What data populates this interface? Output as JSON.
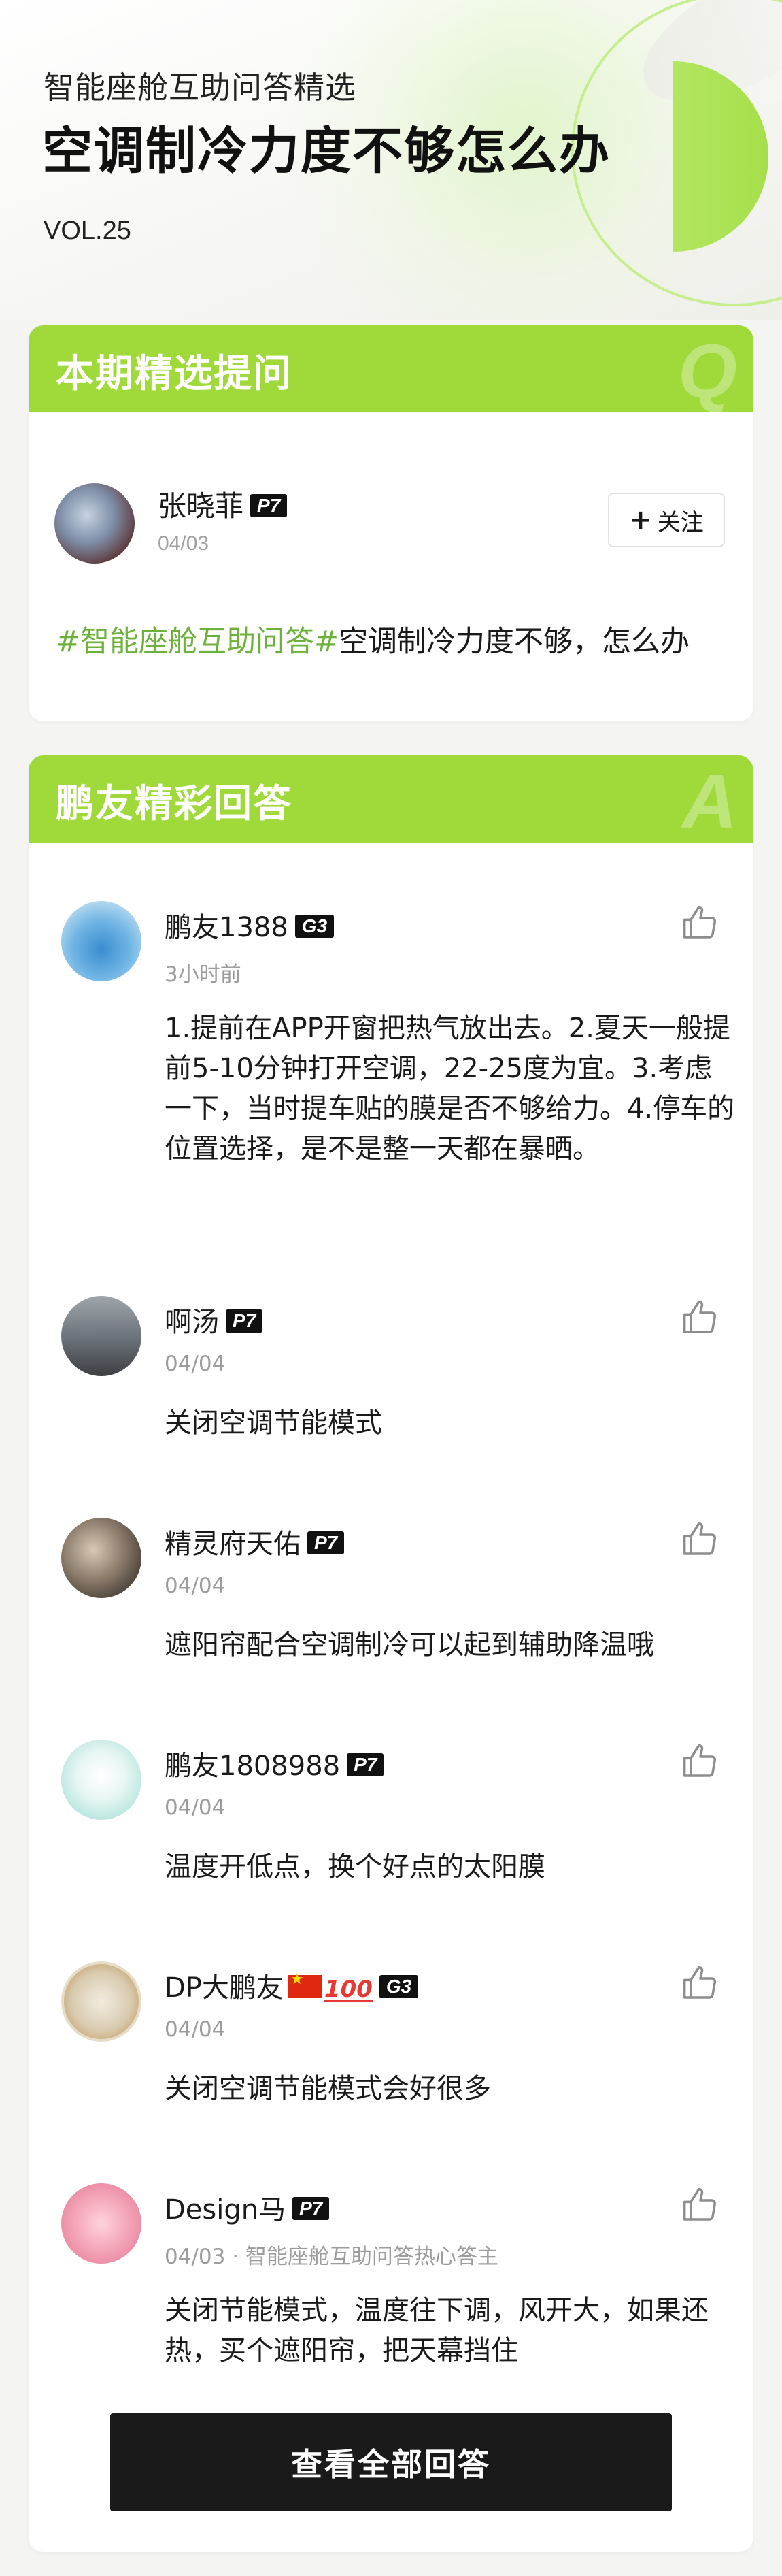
{
  "header": {
    "subtitle": "智能座舱互助问答精选",
    "title": "空调制冷力度不够怎么办",
    "volume": "VOL.25"
  },
  "colors": {
    "accent": "#9fd93a",
    "tag": "#6cb23a",
    "button": "#1a1a1a"
  },
  "question_card": {
    "section_title": "本期精选提问",
    "section_letter": "Q",
    "user": {
      "name": "张晓菲",
      "badge": "P7",
      "date": "04/03"
    },
    "follow_label": "关注",
    "follow_icon": "plus-icon",
    "topic_tag": "#智能座舱互助问答#",
    "question": "空调制冷力度不够，怎么办"
  },
  "answers_card": {
    "section_title": "鹏友精彩回答",
    "section_letter": "A",
    "like_icon": "thumbs-up-icon",
    "answers": [
      {
        "name": "鹏友1388",
        "badge": "G3",
        "time": "3小时前",
        "text": "1.提前在APP开窗把热气放出去。2.夏天一般提前5-10分钟打开空调，22-25度为宜。3.考虑一下，当时提车贴的膜是否不够给力。4.停车的位置选择，是不是整一天都在暴晒。"
      },
      {
        "name": "啊汤",
        "badge": "P7",
        "time": "04/04",
        "text": "关闭空调节能模式"
      },
      {
        "name": "精灵府天佑",
        "badge": "P7",
        "time": "04/04",
        "text": "遮阳帘配合空调制冷可以起到辅助降温哦"
      },
      {
        "name": "鹏友1808988",
        "badge": "P7",
        "time": "04/04",
        "text": "温度开低点，换个好点的太阳膜"
      },
      {
        "name": "DP大鹏友",
        "name_emoji_1": "flag-china-icon",
        "name_emoji_2": "hundred-points-icon",
        "badge": "G3",
        "time": "04/04",
        "text": "关闭空调节能模式会好很多"
      },
      {
        "name": "Design马",
        "badge": "P7",
        "time": "04/03 · 智能座舱互助问答热心答主",
        "text": "关闭节能模式，温度往下调，风开大，如果还热，买个遮阳帘，把天幕挡住"
      }
    ],
    "view_all_label": "查看全部回答"
  }
}
